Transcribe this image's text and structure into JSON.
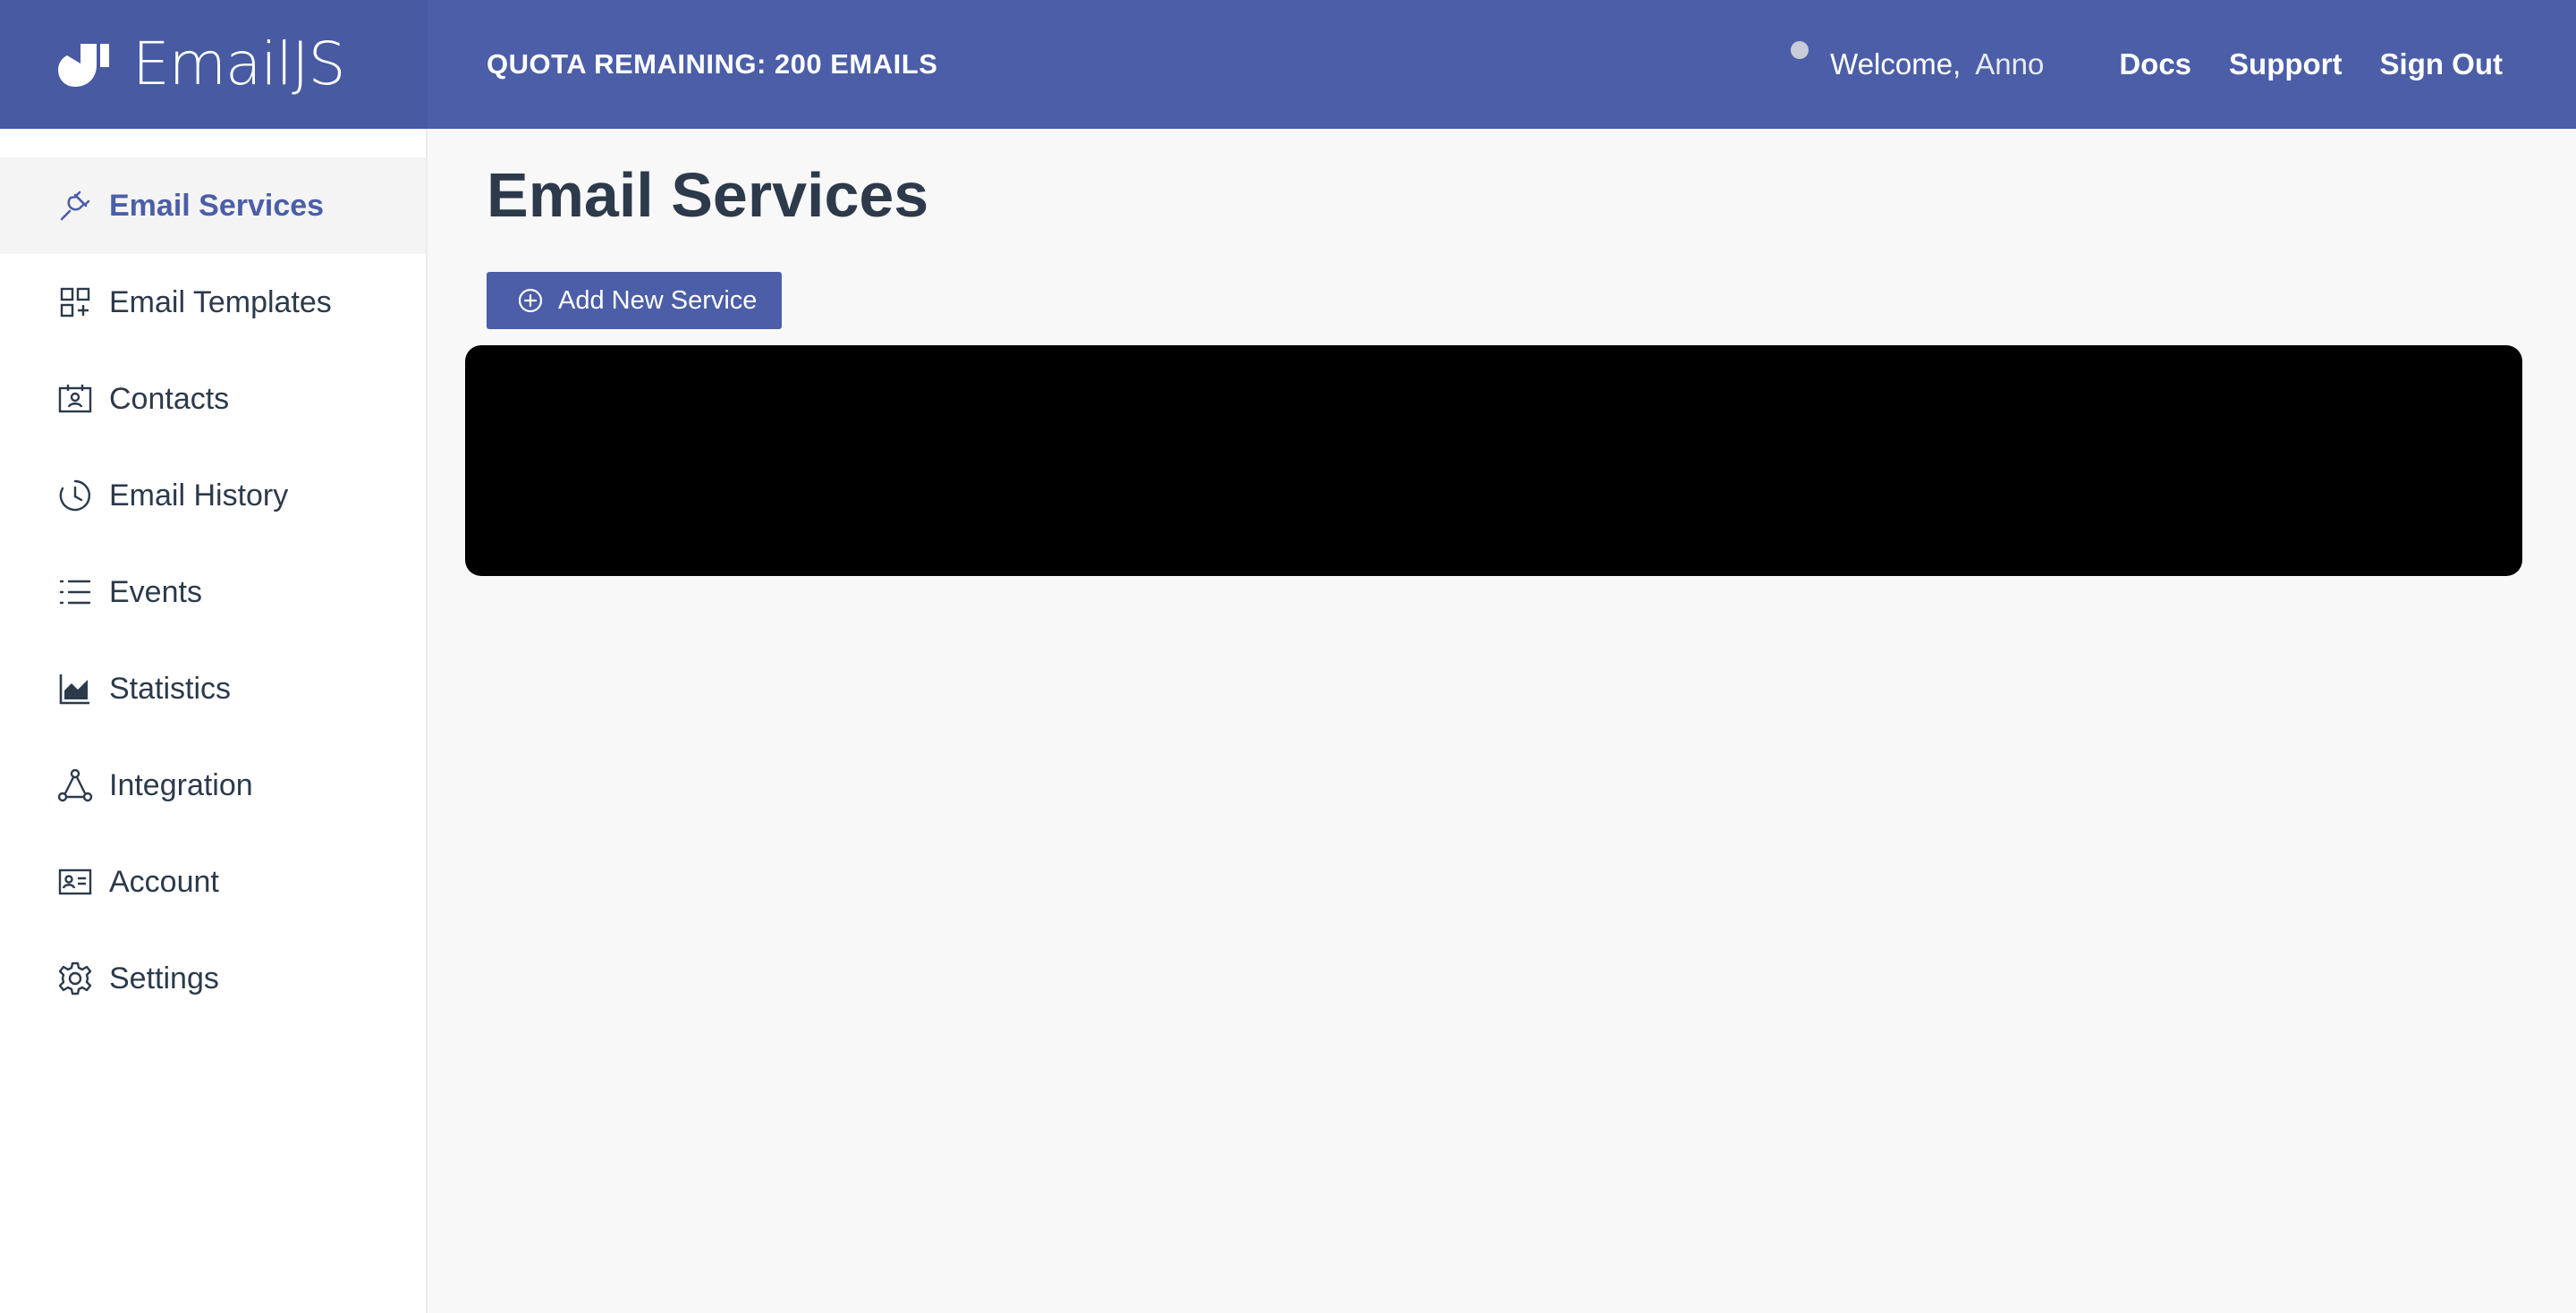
{
  "header": {
    "brand": "EmailJS",
    "quota": "QUOTA REMAINING: 200 EMAILS",
    "welcome": "Welcome,",
    "username": "Anno",
    "links": [
      "Docs",
      "Support",
      "Sign Out"
    ]
  },
  "sidebar": {
    "items": [
      {
        "label": "Email Services",
        "icon": "plug-icon",
        "active": true
      },
      {
        "label": "Email Templates",
        "icon": "templates-grid-icon",
        "active": false
      },
      {
        "label": "Contacts",
        "icon": "contacts-card-icon",
        "active": false
      },
      {
        "label": "Email History",
        "icon": "history-clock-icon",
        "active": false
      },
      {
        "label": "Events",
        "icon": "list-icon",
        "active": false
      },
      {
        "label": "Statistics",
        "icon": "area-chart-icon",
        "active": false
      },
      {
        "label": "Integration",
        "icon": "integration-nodes-icon",
        "active": false
      },
      {
        "label": "Account",
        "icon": "id-card-icon",
        "active": false
      },
      {
        "label": "Settings",
        "icon": "gear-icon",
        "active": false
      }
    ]
  },
  "main": {
    "title": "Email Services",
    "add_button": "Add New Service"
  },
  "colors": {
    "primary": "#4b5ea7",
    "brand_bg": "#475aa2",
    "text": "#2c3a4b",
    "background": "#f8f8f8",
    "redacted": "#000000"
  }
}
